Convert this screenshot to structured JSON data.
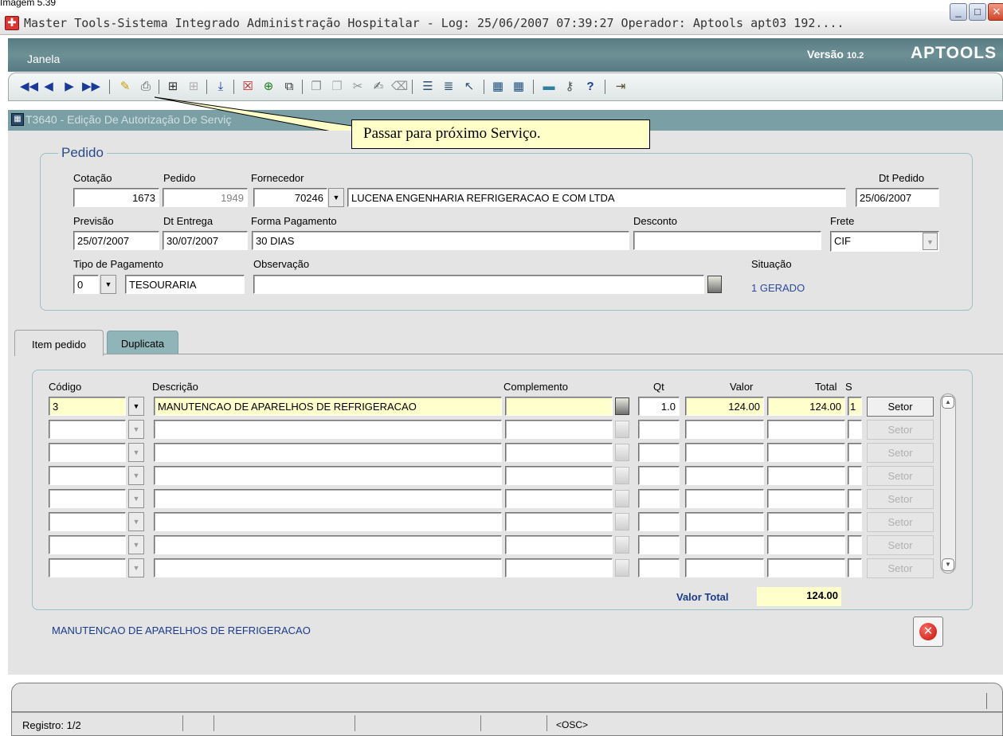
{
  "caption": "Imagem 5.39",
  "window": {
    "title": "Master Tools-Sistema Integrado Administração Hospitalar - Log: 25/06/2007 07:39:27 Operador: Aptools apt03 192....",
    "min_symbol": "_",
    "max_symbol": "□",
    "close_symbol": "✕"
  },
  "menu": {
    "janela": "Janela",
    "version": "Versão",
    "version_number": "10.2",
    "brand": "APTOOLS"
  },
  "toolbar": {
    "icons": [
      "first-record-icon",
      "prev-record-icon",
      "next-record-icon",
      "last-record-icon",
      "edit-icon",
      "print-icon",
      "query-icon",
      "query-disabled-icon",
      "download-icon",
      "delete-record-icon",
      "insert-record-icon",
      "duplicate-icon",
      "copy-icon",
      "paste-disabled-icon",
      "cut-icon",
      "edit-text-icon",
      "clear-icon",
      "list-icon",
      "list-values-icon",
      "help-tool-icon",
      "export-icon",
      "import-icon",
      "image-icon",
      "key-icon",
      "help-icon",
      "exit-icon"
    ]
  },
  "tooltip": "Passar para próximo Serviço.",
  "form": {
    "title": "T3640 - Edição De Autorização De Serviç"
  },
  "pedido": {
    "legend": "Pedido",
    "labels": {
      "cotacao": "Cotação",
      "pedido": "Pedido",
      "fornecedor": "Fornecedor",
      "dt_pedido": "Dt Pedido",
      "previsao": "Previsão",
      "dt_entrega": "Dt Entrega",
      "forma_pagamento": "Forma Pagamento",
      "desconto": "Desconto",
      "frete": "Frete",
      "tipo_pagamento": "Tipo de Pagamento",
      "observacao": "Observação",
      "situacao": "Situação"
    },
    "values": {
      "cotacao": "1673",
      "pedido": "1949",
      "fornecedor_code": "70246",
      "fornecedor_name": "LUCENA ENGENHARIA REFRIGERACAO E COM LTDA",
      "dt_pedido": "25/06/2007",
      "previsao": "25/07/2007",
      "dt_entrega": "30/07/2007",
      "forma_pagamento": "30 DIAS",
      "desconto": "",
      "frete": "CIF",
      "tipo_pagamento_code": "0",
      "tipo_pagamento_name": "TESOURARIA",
      "observacao": "",
      "situacao": "1   GERADO"
    }
  },
  "tabs": {
    "item_pedido": "Item pedido",
    "duplicata": "Duplicata"
  },
  "items": {
    "headers": {
      "codigo": "Código",
      "descricao": "Descrição",
      "complemento": "Complemento",
      "qt": "Qt",
      "valor": "Valor",
      "total": "Total",
      "s": "S"
    },
    "rows": [
      {
        "codigo": "3",
        "descricao": "MANUTENCAO DE APARELHOS DE REFRIGERACAO",
        "complemento": "",
        "qt": "1.0",
        "valor": "124.00",
        "total": "124.00",
        "s": "1",
        "setor": "Setor"
      },
      {
        "codigo": "",
        "descricao": "",
        "complemento": "",
        "qt": "",
        "valor": "",
        "total": "",
        "s": "",
        "setor": "Setor"
      },
      {
        "codigo": "",
        "descricao": "",
        "complemento": "",
        "qt": "",
        "valor": "",
        "total": "",
        "s": "",
        "setor": "Setor"
      },
      {
        "codigo": "",
        "descricao": "",
        "complemento": "",
        "qt": "",
        "valor": "",
        "total": "",
        "s": "",
        "setor": "Setor"
      },
      {
        "codigo": "",
        "descricao": "",
        "complemento": "",
        "qt": "",
        "valor": "",
        "total": "",
        "s": "",
        "setor": "Setor"
      },
      {
        "codigo": "",
        "descricao": "",
        "complemento": "",
        "qt": "",
        "valor": "",
        "total": "",
        "s": "",
        "setor": "Setor"
      },
      {
        "codigo": "",
        "descricao": "",
        "complemento": "",
        "qt": "",
        "valor": "",
        "total": "",
        "s": "",
        "setor": "Setor"
      },
      {
        "codigo": "",
        "descricao": "",
        "complemento": "",
        "qt": "",
        "valor": "",
        "total": "",
        "s": "",
        "setor": "Setor"
      }
    ],
    "valor_total_label": "Valor Total",
    "valor_total": "124.00",
    "selected_description": "MANUTENCAO DE APARELHOS DE REFRIGERACAO"
  },
  "status": {
    "registro": "Registro: 1/2",
    "osc": "<OSC>"
  }
}
